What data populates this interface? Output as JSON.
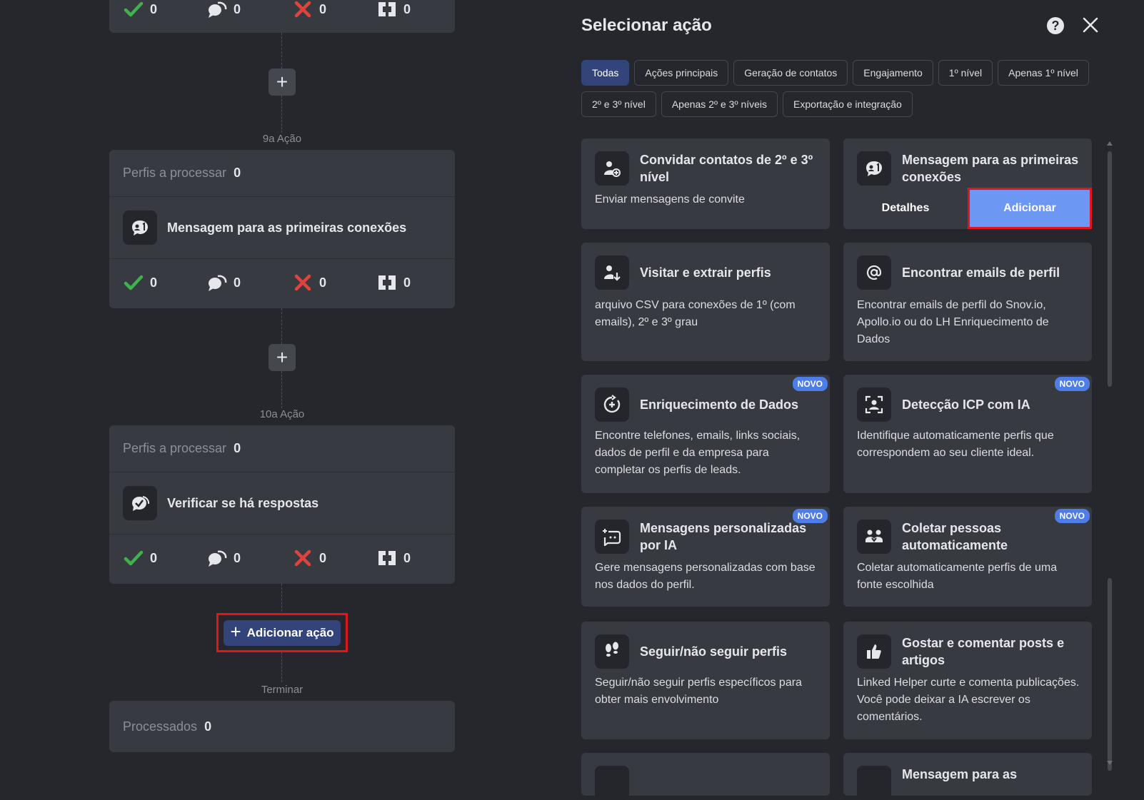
{
  "workflow": {
    "top_stats": {
      "done": "0",
      "replies": "0",
      "failed": "0",
      "skipped": "0"
    },
    "step9": {
      "label": "9a Ação",
      "profiles_label": "Perfis a processar",
      "profiles_count": "0",
      "action_name": "Mensagem para as primeiras conexões",
      "stats": {
        "done": "0",
        "replies": "0",
        "failed": "0",
        "skipped": "0"
      }
    },
    "step10": {
      "label": "10a Ação",
      "profiles_label": "Perfis a processar",
      "profiles_count": "0",
      "action_name": "Verificar se há respostas",
      "stats": {
        "done": "0",
        "replies": "0",
        "failed": "0",
        "skipped": "0"
      }
    },
    "add_action_label": "Adicionar ação",
    "end_label": "Terminar",
    "processed_label": "Processados",
    "processed_count": "0"
  },
  "panel": {
    "title": "Selecionar ação",
    "help_icon": "?",
    "filters": [
      "Todas",
      "Ações principais",
      "Geração de contatos",
      "Engajamento",
      "1º nível",
      "Apenas 1º nível",
      "2º e 3º nível",
      "Apenas 2º e 3º níveis",
      "Exportação e integração"
    ],
    "active_filter": "Todas",
    "new_badge": "NOVO",
    "details_label": "Detalhes",
    "add_label": "Adicionar",
    "actions": [
      {
        "title": "Convidar contatos de 2º e 3º nível",
        "desc": "Enviar mensagens de convite",
        "icon": "invite-user-icon"
      },
      {
        "title": "Mensagem para as primeiras conexões",
        "desc": "",
        "icon": "message-first-connections-icon"
      },
      {
        "title": "Visitar e extrair perfis",
        "desc": "arquivo CSV para conexões de 1º (com emails), 2º e 3º grau",
        "icon": "visit-extract-icon"
      },
      {
        "title": "Encontrar emails de perfil",
        "desc": "Encontrar emails de perfil do Snov.io, Apollo.io ou do LH Enriquecimento de Dados",
        "icon": "at-sign-icon"
      },
      {
        "title": "Enriquecimento de Dados",
        "desc": "Encontre telefones, emails, links sociais, dados de perfil e da empresa para completar os perfis de leads.",
        "icon": "data-enrichment-icon"
      },
      {
        "title": "Detecção ICP com IA",
        "desc": "Identifique automaticamente perfis que correspondem ao seu cliente ideal.",
        "icon": "icp-detection-icon"
      },
      {
        "title": "Mensagens personalizadas por IA",
        "desc": "Gere mensagens personalizadas com base nos dados do perfil.",
        "icon": "ai-message-icon"
      },
      {
        "title": "Coletar pessoas automaticamente",
        "desc": "Coletar automaticamente perfis de uma fonte escolhida",
        "icon": "collect-people-icon"
      },
      {
        "title": "Seguir/não seguir perfis",
        "desc": "Seguir/não seguir perfis específicos para obter mais envolvimento",
        "icon": "footsteps-icon"
      },
      {
        "title": "Gostar e comentar posts e artigos",
        "desc": "Linked Helper curte e comenta publicações. Você pode deixar a IA escrever os comentários.",
        "icon": "thumbs-up-icon"
      },
      {
        "title": "",
        "desc": "",
        "icon": "generic-action-icon"
      },
      {
        "title": "Mensagem para as",
        "desc": "",
        "icon": "message-icon"
      }
    ]
  },
  "colors": {
    "accent": "#324479",
    "add_button": "#6c98f3",
    "badge": "#4f7de8",
    "highlight": "#e3141b",
    "success": "#3fb14d",
    "fail": "#e0433d"
  }
}
